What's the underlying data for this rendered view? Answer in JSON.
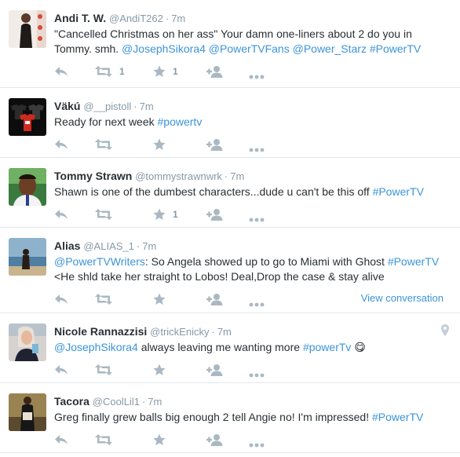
{
  "colors": {
    "link": "#3b94d9",
    "muted": "#8899a6",
    "text": "#292f33",
    "divider": "#e1e8ed",
    "icon": "#aab8c2"
  },
  "tweets": [
    {
      "fullname": "Andi T. W.",
      "username": "@AndiT262",
      "time": "7m",
      "text_parts": [
        {
          "t": "\"Cancelled Christmas on her ass\" Your damn one-liners about 2 do you in Tommy. smh. "
        },
        {
          "t": "@JosephSikora4",
          "k": "mention"
        },
        {
          "t": " "
        },
        {
          "t": "@PowerTVFans",
          "k": "mention"
        },
        {
          "t": " "
        },
        {
          "t": "@Power_Starz",
          "k": "mention"
        },
        {
          "t": " "
        },
        {
          "t": "#PowerTV",
          "k": "hashtag"
        }
      ],
      "retweets": "1",
      "favorites": "1",
      "avatar": "person-photo"
    },
    {
      "fullname": "Väkú",
      "username": "@__pistoll",
      "time": "7m",
      "text_parts": [
        {
          "t": "Ready for next week "
        },
        {
          "t": "#powertv",
          "k": "hashtag"
        }
      ],
      "retweets": "",
      "favorites": "",
      "avatar": "tshirts-photo"
    },
    {
      "fullname": "Tommy Strawn",
      "username": "@tommystrawnwrk",
      "time": "7m",
      "text_parts": [
        {
          "t": "Shawn is one of the dumbest characters...dude u can't be this off "
        },
        {
          "t": "#PowerTV",
          "k": "hashtag"
        }
      ],
      "retweets": "",
      "favorites": "1",
      "avatar": "portrait-photo"
    },
    {
      "fullname": "Alias",
      "username": "@ALIAS_1",
      "time": "7m",
      "text_parts": [
        {
          "t": "@PowerTVWriters",
          "k": "mention"
        },
        {
          "t": ": So Angela showed up to go to Miami with Ghost "
        },
        {
          "t": "#PowerTV",
          "k": "hashtag"
        },
        {
          "t": " <He shld take her straight to Lobos! Deal,Drop the case & stay alive"
        }
      ],
      "retweets": "",
      "favorites": "",
      "view_conversation": "View conversation",
      "avatar": "beach-photo"
    },
    {
      "fullname": "Nicole Rannazzisi",
      "username": "@trickEnicky",
      "time": "7m",
      "text_parts": [
        {
          "t": "@JosephSikora4",
          "k": "mention"
        },
        {
          "t": " always leaving me wanting more "
        },
        {
          "t": "#powerTv",
          "k": "hashtag"
        },
        {
          "t": " 😋"
        }
      ],
      "retweets": "",
      "favorites": "",
      "geo": "location-pin-icon",
      "avatar": "selfie-photo"
    },
    {
      "fullname": "Tacora",
      "username": "@CoolLil1",
      "time": "7m",
      "text_parts": [
        {
          "t": "Greg finally grew balls big enough 2 tell Angie no! I'm impressed! "
        },
        {
          "t": "#PowerTV",
          "k": "hashtag"
        }
      ],
      "retweets": "",
      "favorites": "",
      "avatar": "outfit-photo"
    }
  ]
}
